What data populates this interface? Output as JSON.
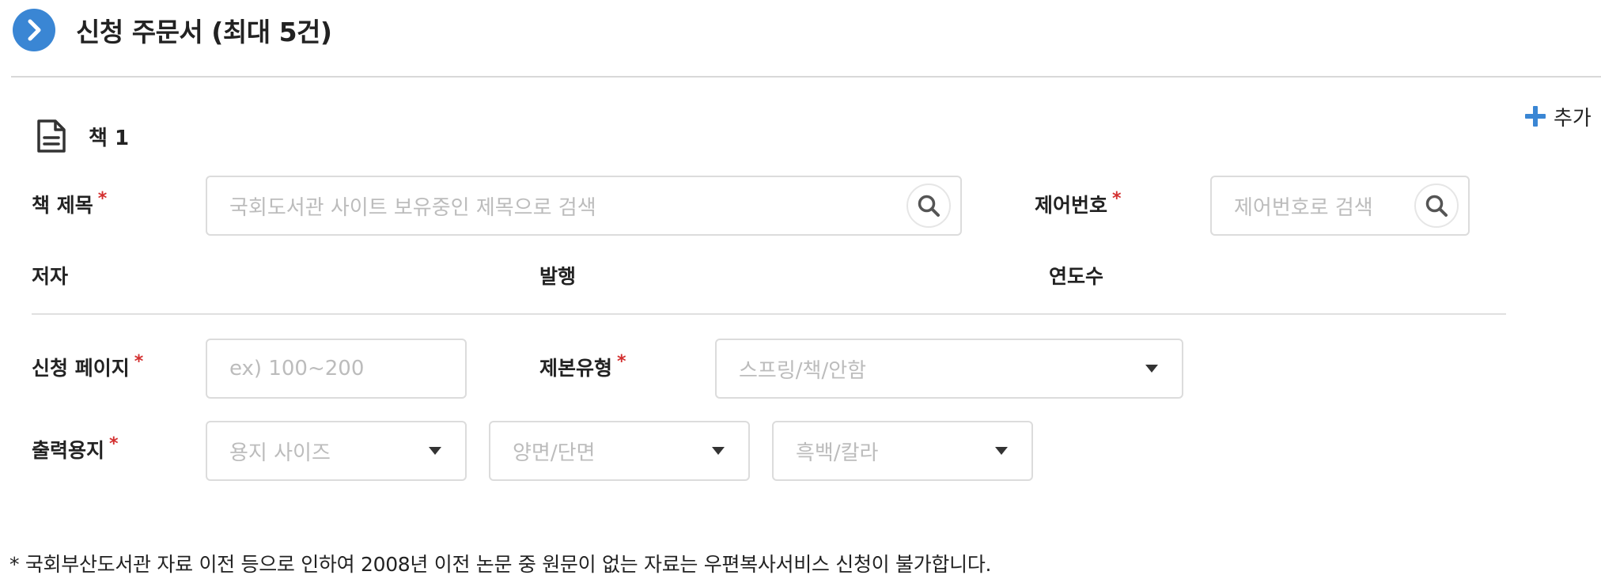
{
  "header": {
    "title": "신청 주문서 (최대 5건)",
    "icon": "chevron-right-icon",
    "accent_color": "#3a86d4"
  },
  "add_button": {
    "label": "추가",
    "icon": "plus-icon"
  },
  "book": {
    "title": "책 1",
    "icon": "document-icon"
  },
  "fields": {
    "book_title": {
      "label": "책 제목",
      "required_mark": "*",
      "placeholder": "국회도서관 사이트 보유중인 제목으로 검색"
    },
    "control_number": {
      "label": "제어번호",
      "required_mark": "*",
      "placeholder": "제어번호로 검색"
    },
    "author": {
      "label": "저자"
    },
    "publisher": {
      "label": "발행"
    },
    "year": {
      "label": "연도수"
    },
    "pages": {
      "label": "신청 페이지",
      "required_mark": "*",
      "placeholder": "ex) 100~200"
    },
    "binding": {
      "label": "제본유형",
      "required_mark": "*",
      "selected": "스프링/책/안함"
    },
    "paper": {
      "label": "출력용지",
      "required_mark": "*",
      "size_selected": "용지 사이즈",
      "sides_selected": "양면/단면",
      "color_selected": "흑백/칼라"
    }
  },
  "notice": "* 국회부산도서관 자료 이전 등으로 인하여 2008년 이전 논문 중 원문이 없는 자료는 우편복사서비스 신청이 불가합니다.",
  "colors": {
    "required": "#d32f2f",
    "border": "#dcdcdc",
    "placeholder": "#bcbcbc"
  }
}
